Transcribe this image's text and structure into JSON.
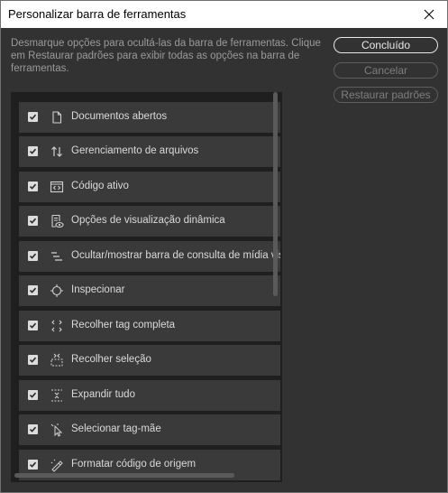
{
  "window": {
    "title": "Personalizar barra de ferramentas",
    "close_icon": "close-icon"
  },
  "description": "Desmarque opções para ocultá-las da barra de ferramentas. Clique em Restaurar padrões para exibir todas as opções na barra de ferramentas.",
  "buttons": {
    "done": "Concluído",
    "cancel": "Cancelar",
    "restore": "Restaurar padrões"
  },
  "items": [
    {
      "label": "Documentos abertos",
      "icon": "document-icon",
      "checked": true
    },
    {
      "label": "Gerenciamento de arquivos",
      "icon": "file-transfer-icon",
      "checked": true
    },
    {
      "label": "Código ativo",
      "icon": "live-code-icon",
      "checked": true
    },
    {
      "label": "Opções de visualização dinâmica",
      "icon": "live-view-options-icon",
      "checked": true
    },
    {
      "label": "Ocultar/mostrar barra de consulta de mídia visual",
      "icon": "media-query-bar-icon",
      "checked": true
    },
    {
      "label": "Inspecionar",
      "icon": "inspect-icon",
      "checked": true
    },
    {
      "label": "Recolher tag completa",
      "icon": "collapse-tag-icon",
      "checked": true
    },
    {
      "label": "Recolher seleção",
      "icon": "collapse-selection-icon",
      "checked": true
    },
    {
      "label": "Expandir tudo",
      "icon": "expand-all-icon",
      "checked": true
    },
    {
      "label": "Selecionar tag-mãe",
      "icon": "select-parent-tag-icon",
      "checked": true
    },
    {
      "label": "Formatar código de origem",
      "icon": "format-source-icon",
      "checked": true
    }
  ],
  "colors": {
    "background": "#323232",
    "list_background": "#1f1f1f",
    "row_background": "#3a3a3a",
    "text": "#dadada"
  }
}
